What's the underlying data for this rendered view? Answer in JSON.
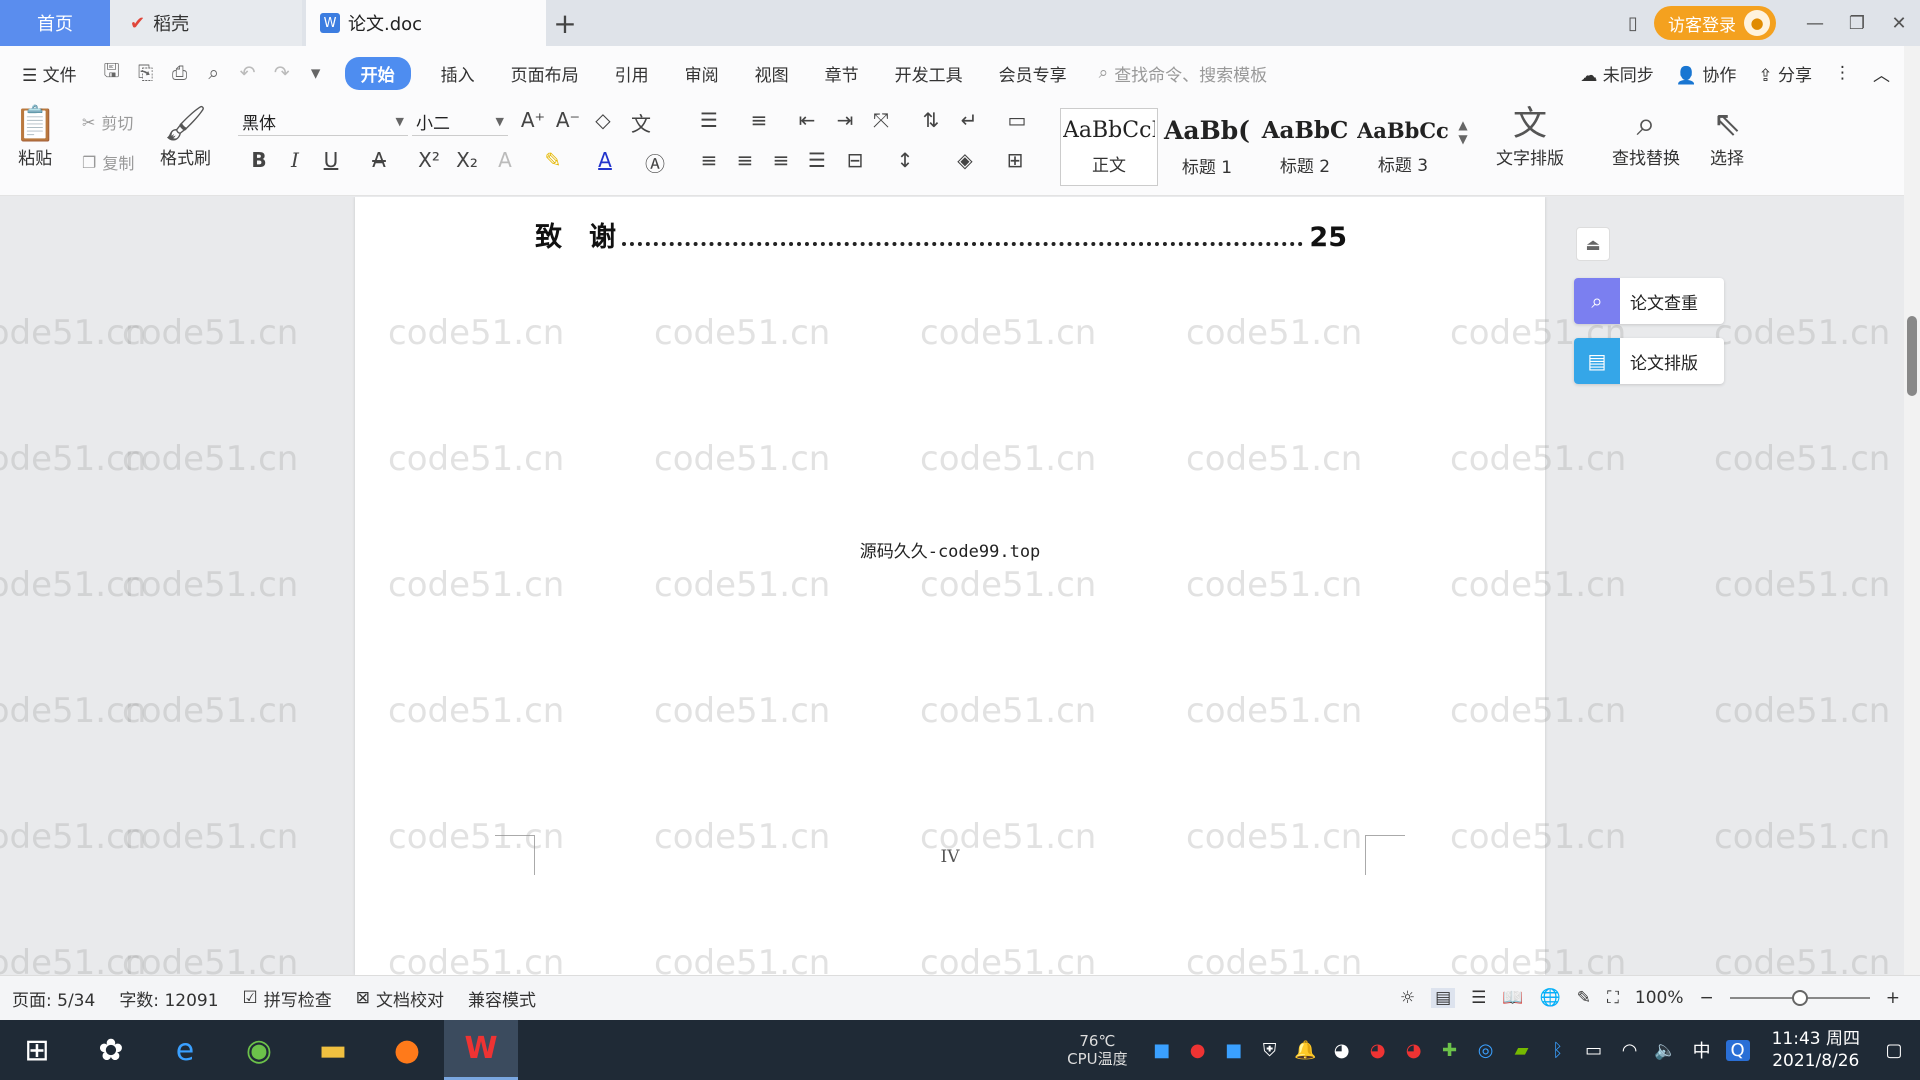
{
  "tabs": {
    "home": "首页",
    "daoke": "稻壳",
    "doc": "论文.doc",
    "new_tab": "+"
  },
  "titlebar": {
    "login": "访客登录"
  },
  "menu": {
    "file": "文件",
    "items": [
      "开始",
      "插入",
      "页面布局",
      "引用",
      "审阅",
      "视图",
      "章节",
      "开发工具",
      "会员专享"
    ],
    "search_placeholder": "查找命令、搜索模板",
    "unsynced": "未同步",
    "collab": "协作",
    "share": "分享"
  },
  "ribbon": {
    "paste": "粘贴",
    "cut": "剪切",
    "copy": "复制",
    "format_painter": "格式刷",
    "font_name": "黑体",
    "font_size": "小二",
    "styles": [
      {
        "preview": "AaBbCcI",
        "label": "正文"
      },
      {
        "preview": "AaBb(",
        "label": "标题 1"
      },
      {
        "preview": "AaBbC",
        "label": "标题 2"
      },
      {
        "preview": "AaBbCcl",
        "label": "标题 3"
      }
    ],
    "text_layout": "文字排版",
    "find_replace": "查找替换",
    "select": "选择"
  },
  "document": {
    "toc_entry_label": "致　谢",
    "toc_entry_page": "25",
    "footer_text": "源码久久-code99.top",
    "page_number": "IV",
    "watermark": "code51.cn"
  },
  "side_panel": {
    "check": "论文查重",
    "layout": "论文排版"
  },
  "status": {
    "page": "页面: 5/34",
    "words": "字数: 12091",
    "spell": "拼写检查",
    "proof": "文档校对",
    "compat": "兼容模式",
    "zoom": "100%",
    "zoom_level": 0.5
  },
  "taskbar": {
    "cpu_temp": "76℃",
    "cpu_label": "CPU温度",
    "time": "11:43 周四",
    "date": "2021/8/26",
    "ime": "中"
  },
  "colors": {
    "accent": "#4e8df0",
    "home_tab": "#5a8dee",
    "login": "#f4a11f",
    "taskbar": "#1f2a36"
  }
}
